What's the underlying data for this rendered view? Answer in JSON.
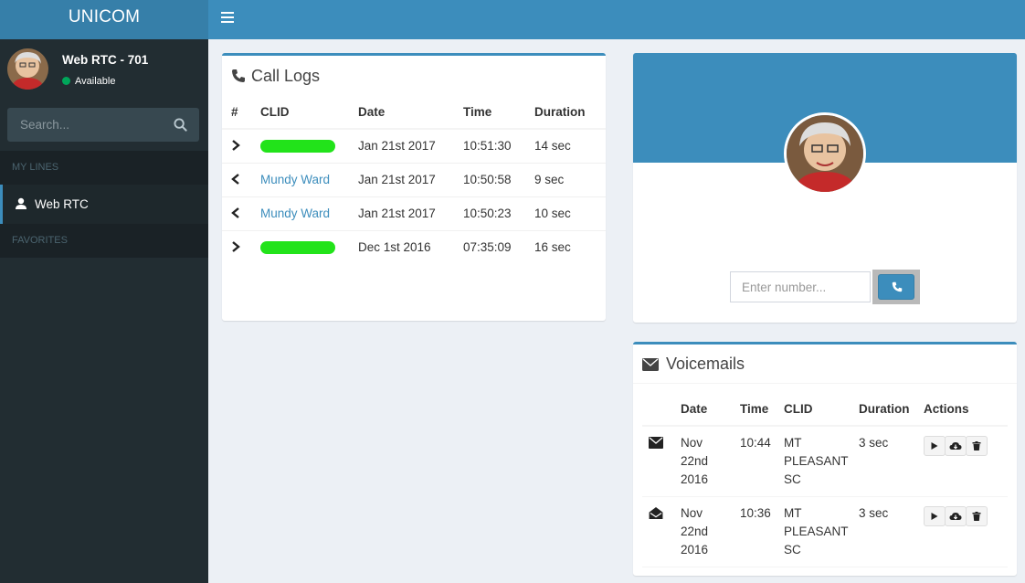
{
  "app": {
    "logo": "UNICOM"
  },
  "sidebar": {
    "user_name": "Web RTC - 701",
    "user_status": "Available",
    "search_placeholder": "Search...",
    "section_lines": "MY LINES",
    "line_item": "Web RTC",
    "section_favorites": "FAVORITES"
  },
  "call_logs": {
    "title": "Call Logs",
    "headers": [
      "#",
      "CLID",
      "Date",
      "Time",
      "Duration"
    ],
    "rows": [
      {
        "direction": "outgoing",
        "clid": "",
        "date": "Jan 21st 2017",
        "time": "10:51:30",
        "duration": "14 sec"
      },
      {
        "direction": "incoming",
        "clid": "Mundy Ward",
        "date": "Jan 21st 2017",
        "time": "10:50:58",
        "duration": "9 sec"
      },
      {
        "direction": "incoming",
        "clid": "Mundy Ward",
        "date": "Jan 21st 2017",
        "time": "10:50:23",
        "duration": "10 sec"
      },
      {
        "direction": "outgoing",
        "clid": "",
        "date": "Dec 1st 2016",
        "time": "07:35:09",
        "duration": "16 sec"
      }
    ]
  },
  "dialer": {
    "placeholder": "Enter number..."
  },
  "voicemails": {
    "title": "Voicemails",
    "headers": [
      "",
      "Date",
      "Time",
      "CLID",
      "Duration",
      "Actions"
    ],
    "rows": [
      {
        "status": "unread",
        "date_lines": [
          "Nov",
          "22nd",
          "2016"
        ],
        "time": "10:44",
        "clid_lines": [
          "MT",
          "PLEASANT",
          "SC"
        ],
        "duration": "3 sec"
      },
      {
        "status": "read",
        "date_lines": [
          "Nov",
          "22nd",
          "2016"
        ],
        "time": "10:36",
        "clid_lines": [
          "MT",
          "PLEASANT",
          "SC"
        ],
        "duration": "3 sec"
      }
    ]
  },
  "colors": {
    "brand": "#3c8dbc",
    "brand_dark": "#367fa9",
    "sidebar": "#222d32",
    "status_green": "#00a65a",
    "redaction": "#22e31a"
  }
}
